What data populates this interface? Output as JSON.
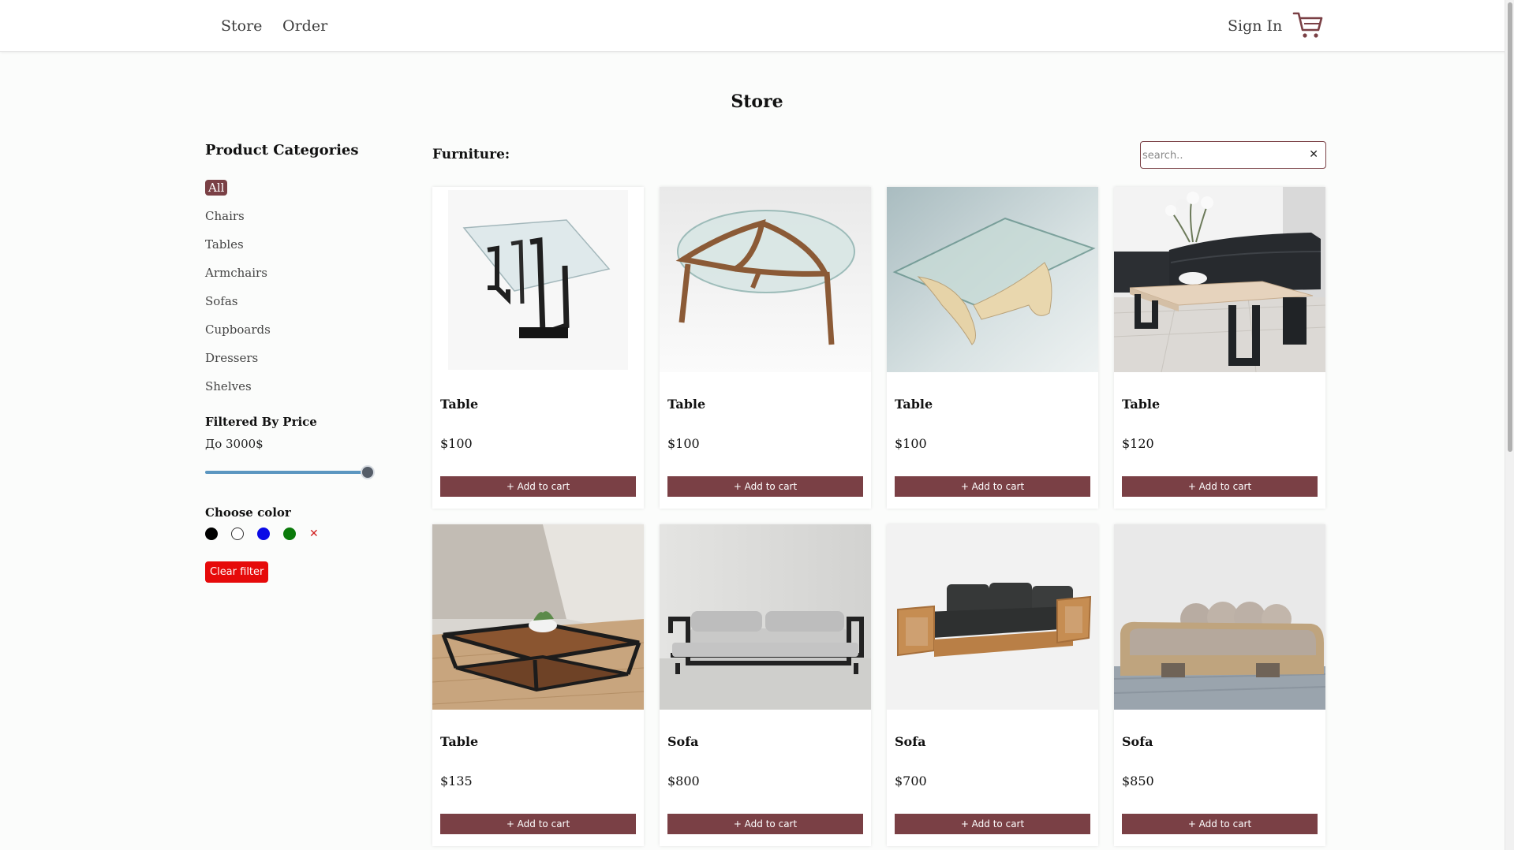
{
  "nav": {
    "store": "Store",
    "order": "Order",
    "sign_in": "Sign In",
    "cart_icon": "shopping-cart-icon"
  },
  "page_title": "Store",
  "sidebar": {
    "title": "Product Categories",
    "categories": [
      "All",
      "Chairs",
      "Tables",
      "Armchairs",
      "Sofas",
      "Cupboards",
      "Dressers",
      "Shelves"
    ],
    "active_category": "All",
    "price_title": "Filtered By Price",
    "price_value": "До 3000$",
    "price_slider": {
      "value": 3000,
      "max": 3000
    },
    "color_title": "Choose color",
    "colors": [
      "#000000",
      "#ffffff",
      "#0a0ae6",
      "#0a7a0a"
    ],
    "clear_color_icon": "close-icon",
    "clear_filter": "Clear filter"
  },
  "main": {
    "section_label": "Furniture:",
    "search_placeholder": "search..",
    "search_value": "",
    "add_to_cart": "+ Add to cart",
    "products": [
      {
        "name": "Table",
        "price": "$100"
      },
      {
        "name": "Table",
        "price": "$100"
      },
      {
        "name": "Table",
        "price": "$100"
      },
      {
        "name": "Table",
        "price": "$120"
      },
      {
        "name": "Table",
        "price": "$135"
      },
      {
        "name": "Sofa",
        "price": "$800"
      },
      {
        "name": "Sofa",
        "price": "$700"
      },
      {
        "name": "Sofa",
        "price": "$850"
      }
    ]
  },
  "colors": {
    "accent": "#7a4045",
    "danger": "#e60a0a",
    "slider": "#5b96c0"
  }
}
